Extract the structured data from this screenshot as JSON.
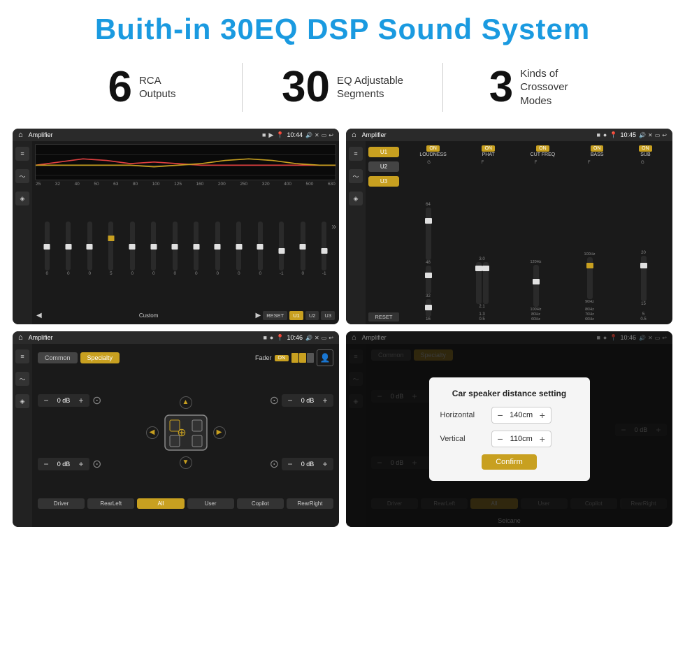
{
  "header": {
    "title": "Buith-in 30EQ DSP Sound System"
  },
  "stats": [
    {
      "number": "6",
      "label": "RCA\nOutputs"
    },
    {
      "number": "30",
      "label": "EQ Adjustable\nSegments"
    },
    {
      "number": "3",
      "label": "Kinds of\nCrossover Modes"
    }
  ],
  "panels": {
    "top_left": {
      "app": "Amplifier",
      "time": "10:44",
      "freq_labels": [
        "25",
        "32",
        "40",
        "50",
        "63",
        "80",
        "100",
        "125",
        "160",
        "200",
        "250",
        "320",
        "400",
        "500",
        "630"
      ],
      "slider_values": [
        "0",
        "0",
        "0",
        "5",
        "0",
        "0",
        "0",
        "0",
        "0",
        "0",
        "0",
        "-1",
        "0",
        "-1"
      ],
      "buttons": [
        "RESET",
        "U1",
        "U2",
        "U3"
      ],
      "label": "Custom"
    },
    "top_right": {
      "app": "Amplifier",
      "time": "10:45",
      "channel_buttons": [
        "U1",
        "U2",
        "U3"
      ],
      "on_labels": [
        "ON",
        "ON",
        "ON",
        "ON",
        "ON"
      ],
      "feature_labels": [
        "LOUDNESS",
        "PHAT",
        "CUT FREQ",
        "BASS",
        "SUB"
      ],
      "reset_label": "RESET"
    },
    "bottom_left": {
      "app": "Amplifier",
      "time": "10:46",
      "tabs": [
        "Common",
        "Specialty"
      ],
      "fader_label": "Fader",
      "on_label": "ON",
      "speaker_values": [
        "0 dB",
        "0 dB",
        "0 dB",
        "0 dB"
      ],
      "position_buttons": [
        "Driver",
        "RearLeft",
        "All",
        "User",
        "Copilot",
        "RearRight"
      ]
    },
    "bottom_right": {
      "app": "Amplifier",
      "time": "10:46",
      "tabs": [
        "Common",
        "Specialty"
      ],
      "dialog": {
        "title": "Car speaker distance setting",
        "horizontal_label": "Horizontal",
        "horizontal_value": "140cm",
        "vertical_label": "Vertical",
        "vertical_value": "110cm",
        "confirm_label": "Confirm"
      },
      "db_values": [
        "0 dB"
      ],
      "position_buttons": [
        "Driver",
        "RearLeft",
        "User",
        "Copilot",
        "RearRight"
      ]
    }
  },
  "watermark": "Seicane"
}
